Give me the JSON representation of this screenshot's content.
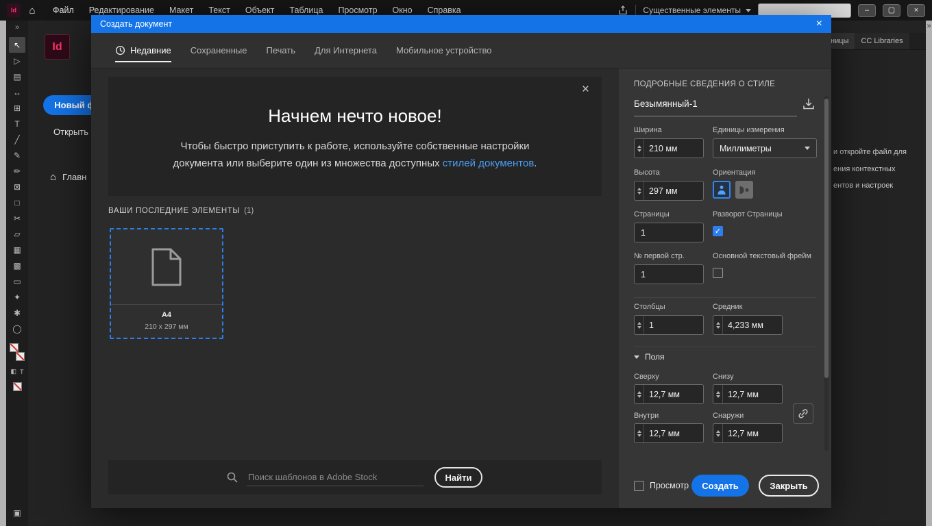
{
  "appbar": {
    "menu_items": [
      "Файл",
      "Редактирование",
      "Макет",
      "Текст",
      "Объект",
      "Таблица",
      "Просмотр",
      "Окно",
      "Справка"
    ],
    "workspace": "Существенные элементы",
    "logo": "Id"
  },
  "icons": {
    "close": "×",
    "double_chevron": "»",
    "home": "⌂",
    "minimize": "–",
    "restore": "▢"
  },
  "tools": [
    {
      "name": "selection",
      "glyph": "↖"
    },
    {
      "name": "direct-selection",
      "glyph": "▷"
    },
    {
      "name": "page",
      "glyph": "▤"
    },
    {
      "name": "gap",
      "glyph": "↔"
    },
    {
      "name": "content-collector",
      "glyph": "⊞"
    },
    {
      "name": "type",
      "glyph": "T"
    },
    {
      "name": "line",
      "glyph": "╱"
    },
    {
      "name": "pen",
      "glyph": "✎"
    },
    {
      "name": "pencil",
      "glyph": "✏"
    },
    {
      "name": "rectangle-frame",
      "glyph": "⊠"
    },
    {
      "name": "rectangle",
      "glyph": "□"
    },
    {
      "name": "scissors",
      "glyph": "✂"
    },
    {
      "name": "free-transform",
      "glyph": "▱"
    },
    {
      "name": "gradient-swatch",
      "glyph": "▦"
    },
    {
      "name": "gradient-feather",
      "glyph": "▩"
    },
    {
      "name": "note",
      "glyph": "▭"
    },
    {
      "name": "eyedropper",
      "glyph": "✦"
    },
    {
      "name": "hand",
      "glyph": "✱"
    },
    {
      "name": "zoom",
      "glyph": "◯"
    }
  ],
  "mini_icons": {
    "formatting": "T",
    "container": "◧",
    "screen_mode": "▣"
  },
  "home": {
    "logo": "Id",
    "new_file": "Новый ф",
    "open": "Открыть",
    "home_tab": "Главн"
  },
  "panels": {
    "pages_tab": "ницы",
    "cc_tab": "CC Libraries",
    "lines": [
      "и откройте файл для",
      "ения контекстных",
      "ентов и настроек"
    ]
  },
  "dialog": {
    "title": "Создать документ",
    "tabs": {
      "recent": "Недавние",
      "saved": "Сохраненные",
      "print": "Печать",
      "web": "Для Интернета",
      "mobile": "Мобильное устройство"
    },
    "hero": {
      "title": "Начнем нечто новое!",
      "line1": "Чтобы быстро приступить к работе, используйте собственные настройки",
      "line2_pre": "документа или выберите один из множества доступных ",
      "line2_link": "стилей документов",
      "line2_post": "."
    },
    "recent": {
      "heading": "ВАШИ ПОСЛЕДНИЕ ЭЛЕМЕНТЫ",
      "count": "(1)",
      "item": {
        "name": "A4",
        "size": "210 x 297 мм"
      }
    },
    "stock_search": {
      "placeholder": "Поиск шаблонов в Adobe Stock",
      "button": "Найти"
    },
    "details": {
      "heading": "ПОДРОБНЫЕ СВЕДЕНИЯ О СТИЛЕ",
      "doc_name": "Безымянный-1",
      "width": {
        "label": "Ширина",
        "value": "210 мм"
      },
      "units": {
        "label": "Единицы измерения",
        "value": "Миллиметры"
      },
      "height": {
        "label": "Высота",
        "value": "297 мм"
      },
      "orientation": {
        "label": "Ориентация",
        "selected": "portrait"
      },
      "pages": {
        "label": "Страницы",
        "value": "1"
      },
      "facing": {
        "label": "Разворот Страницы",
        "checked": true
      },
      "start_page": {
        "label": "№ первой стр.",
        "value": "1"
      },
      "primary_text_frame": {
        "label": "Основной текстовый фрейм",
        "checked": false
      },
      "columns": {
        "label": "Столбцы",
        "value": "1"
      },
      "gutter": {
        "label": "Средник",
        "value": "4,233 мм"
      },
      "margins": {
        "label": "Поля",
        "top": {
          "label": "Сверху",
          "value": "12,7 мм"
        },
        "bottom": {
          "label": "Снизу",
          "value": "12,7 мм"
        },
        "inside": {
          "label": "Внутри",
          "value": "12,7 мм"
        },
        "outside": {
          "label": "Снаружи",
          "value": "12,7 мм"
        }
      },
      "preview": {
        "label": "Просмотр",
        "checked": false
      },
      "create_button": "Создать",
      "close_button": "Закрыть"
    }
  },
  "colors": {
    "accent": "#1473e6",
    "link": "#4a9ff5",
    "id_logo_bg": "#2e0a18",
    "id_logo_fg": "#ff3366"
  }
}
